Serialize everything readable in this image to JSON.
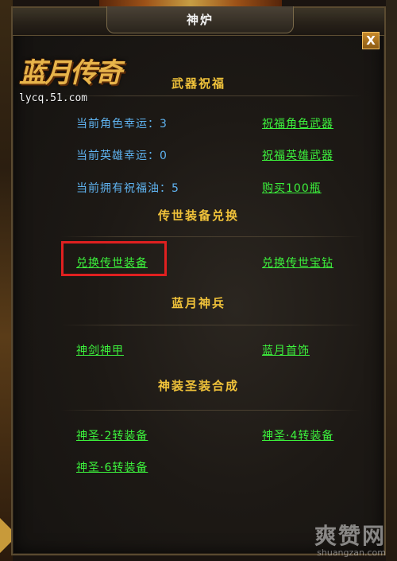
{
  "window": {
    "title": "神炉",
    "close_label": "X"
  },
  "logo": {
    "text": "蓝月传奇",
    "url": "lycq.51.com"
  },
  "sections": {
    "blessing": {
      "title": "武器祝福",
      "info": [
        "当前角色幸运：3",
        "当前英雄幸运：0",
        "当前拥有祝福油：5"
      ],
      "links": [
        "祝福角色武器",
        "祝福英雄武器",
        "购买100瓶"
      ]
    },
    "legacy": {
      "title": "传世装备兑换",
      "links": [
        "兑换传世装备",
        "兑换传世宝钻"
      ]
    },
    "divine": {
      "title": "蓝月神兵",
      "links": [
        "神剑神甲",
        "蓝月首饰"
      ]
    },
    "synthesis": {
      "title": "神装圣装合成",
      "links": [
        "神圣·2转装备",
        "神圣·4转装备",
        "神圣·6转装备"
      ]
    }
  },
  "watermark": {
    "main": "爽赞网",
    "sub": "shuangzan.com"
  },
  "colors": {
    "section_title": "#f0c23a",
    "info_text": "#5fb3f0",
    "link_text": "#3cf23c",
    "highlight": "#e02020"
  }
}
